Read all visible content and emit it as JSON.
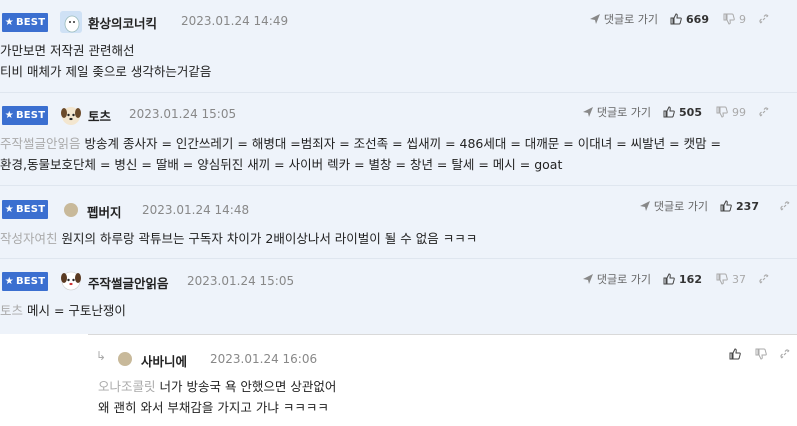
{
  "best_label": "BEST",
  "reply_label": "댓글로 가기",
  "comments": [
    {
      "nick": "환상의코너킥",
      "date": "2023.01.24 14:49",
      "up": "669",
      "down": "9",
      "mention": "",
      "lines": [
        "가만보면 저작권 관련해선",
        "티비 매체가 제일 좆으로 생각하는거같음"
      ]
    },
    {
      "nick": "토츠",
      "date": "2023.01.24 15:05",
      "up": "505",
      "down": "99",
      "mention": "주작썰글안읽음",
      "lines": [
        "방송계 종사자 = 인간쓰레기 = 해병대 =범죄자 = 조선족 = 씹새끼 = 486세대 = 대깨문 = 이대녀 = 씨발년 = 캣맘 =",
        "환경,동물보호단체 = 병신 = 딸배 = 양심뒤진 새끼 = 사이버 렉카 = 별창 = 창년 = 탈세 = 메시 = goat"
      ]
    },
    {
      "nick": "펩버지",
      "date": "2023.01.24 14:48",
      "up": "237",
      "down": "",
      "mention": "작성자여친",
      "lines": [
        "원지의 하루랑 곽튜브는 구독자 차이가 2배이상나서 라이벌이 될 수 없음 ㅋㅋㅋ"
      ]
    },
    {
      "nick": "주작썰글안읽음",
      "date": "2023.01.24 15:05",
      "up": "162",
      "down": "37",
      "mention": "토츠",
      "lines": [
        "메시 = 구토난쟁이"
      ]
    }
  ],
  "reply": {
    "nick": "사바니에",
    "date": "2023.01.24 16:06",
    "mention": "오나조콜릿",
    "lines": [
      "너가 방송국 욕 안했으면 상관없어",
      "왜 괜히 와서 부채감을 가지고 가냐 ㅋㅋㅋㅋ"
    ]
  }
}
